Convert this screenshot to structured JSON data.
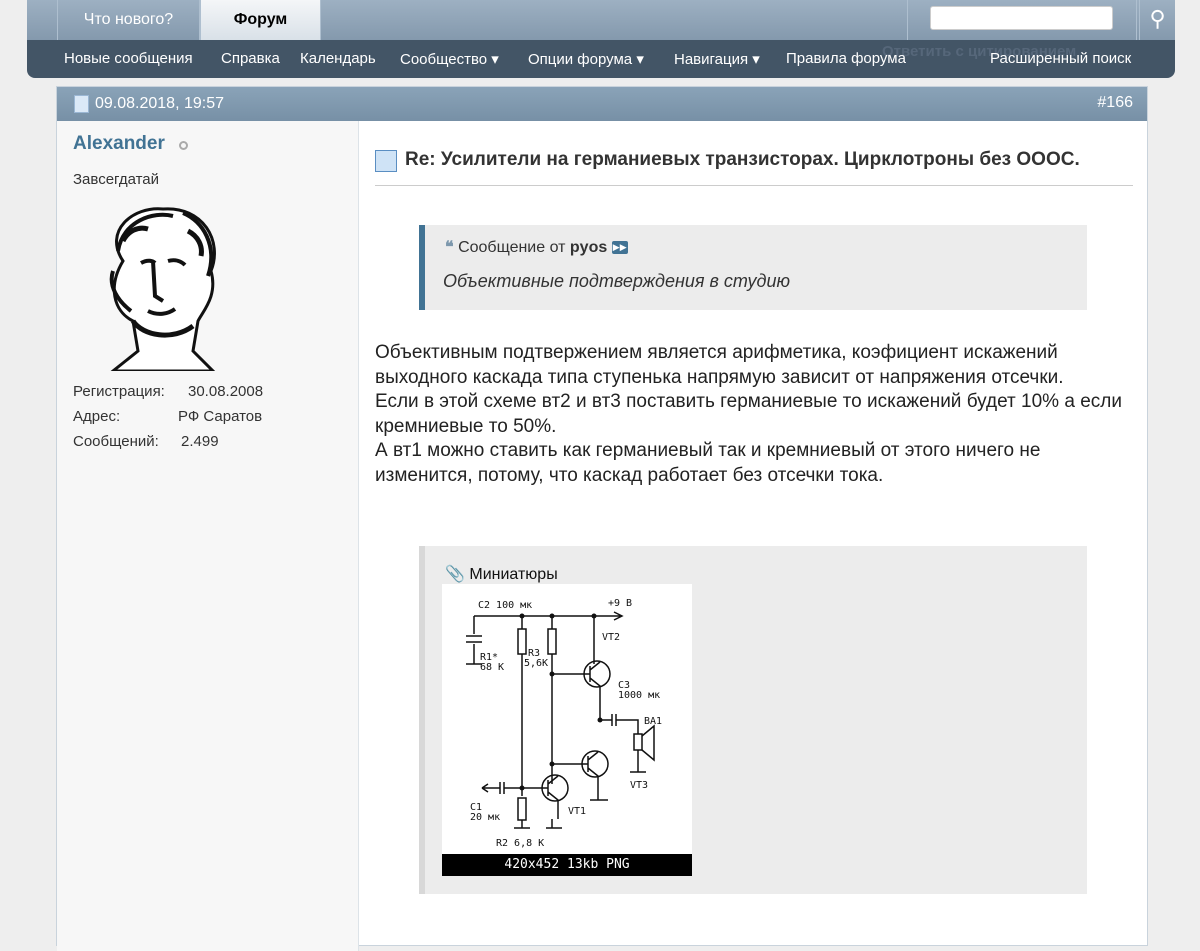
{
  "navbar": {
    "tabs": [
      {
        "label": "Что нового?"
      },
      {
        "label": "Форум"
      }
    ],
    "search_placeholder": "",
    "links": [
      {
        "label": "Новые сообщения"
      },
      {
        "label": "Справка"
      },
      {
        "label": "Календарь"
      },
      {
        "label": "Сообщество ▾"
      },
      {
        "label": "Опции форума ▾"
      },
      {
        "label": "Навигация ▾"
      },
      {
        "label": "Правила форума"
      }
    ],
    "advanced_search": "Расширенный поиск",
    "reply_quote_ghost": "Ответить с цитированием"
  },
  "post": {
    "date": "09.08.2018, 19:57",
    "number": "#166",
    "user": {
      "name": "Alexander",
      "title": "Завсегдатай",
      "stats": [
        {
          "label": "Регистрация:",
          "value": "30.08.2008"
        },
        {
          "label": "Адрес:",
          "value": "РФ Саратов"
        },
        {
          "label": "Сообщений:",
          "value": "2.499"
        }
      ]
    },
    "title": "Re: Усилители на германиевых транзисторах. Цирклотроны без ОООС.",
    "quote": {
      "prefix": "Сообщение от",
      "author": "pyos",
      "text": "Объективные подтверждения в студию"
    },
    "body": [
      "Объективным подтвержением является арифметика, коэфициент искажений выходного каскада типа ступенька напрямую зависит от напряжения отсечки.",
      "Если в этой схеме вт2 и вт3 поставить германиевые то искажений будет 10% а если кремниевые то 50%.",
      "А вт1 можно ставить как германиевый так и кремниевый от этого ничего не изменится, потому, что каскад работает без отсечки тока."
    ],
    "attachments": {
      "label": "Миниатюры",
      "thumbnail_caption": "420x452 13kb PNG",
      "schematic_labels": {
        "c2": "C2 100 мк",
        "vplus": "+9 В",
        "vt2": "VT2",
        "r1": "R1*",
        "r1v": "68 К",
        "r3": "R3",
        "r3v": "5,6К",
        "c3": "C3",
        "c3v": "1000 мк",
        "ba1": "BA1",
        "vt3": "VT3",
        "c1": "C1",
        "c1v": "20 мк",
        "vt1": "VT1",
        "r2": "R2 6,8 К"
      }
    }
  }
}
